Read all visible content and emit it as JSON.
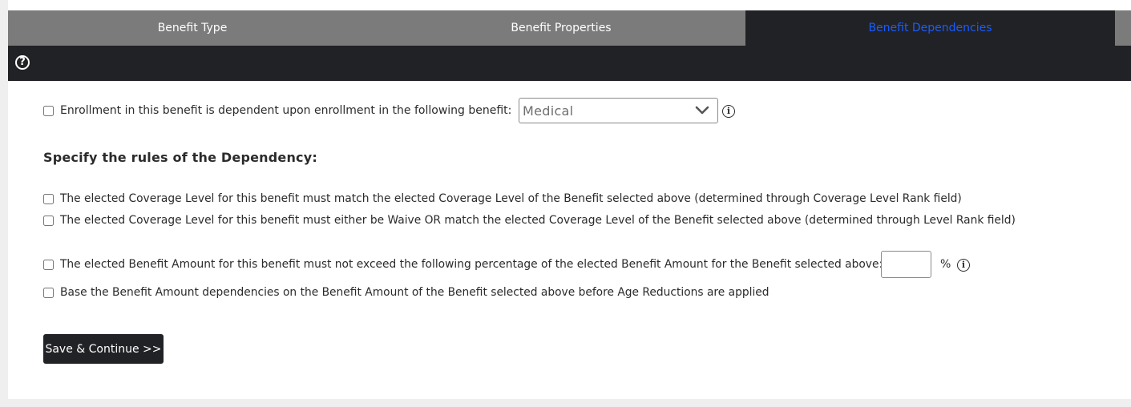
{
  "tabs": [
    {
      "label": "Benefit Type",
      "active": false
    },
    {
      "label": "Benefit Properties",
      "active": false
    },
    {
      "label": "Benefit Dependencies",
      "active": true
    }
  ],
  "help_icon": "question-circle-icon",
  "dependency": {
    "label": "Enrollment in this benefit is dependent upon enrollment in the following benefit:",
    "checked": false,
    "selected_benefit": "Medical",
    "info_icon": "info-circle-icon"
  },
  "rules_heading": "Specify the rules of the Dependency:",
  "rules": {
    "coverage_match": {
      "label": "The elected Coverage Level for this benefit must match the elected Coverage Level of the Benefit selected above (determined through Coverage Level Rank field)",
      "checked": false
    },
    "coverage_waive_or_match": {
      "label": "The elected Coverage Level for this benefit must either be Waive OR match the elected Coverage Level of the Benefit selected above (determined through Level Rank field)",
      "checked": false
    },
    "amount_limit": {
      "label": "The elected Benefit Amount for this benefit must not exceed the following percentage of the elected Benefit Amount for the Benefit selected above:",
      "checked": false,
      "percent_value": "",
      "percent_symbol": "%"
    },
    "age_reduction": {
      "label": "Base the Benefit Amount dependencies on the Benefit Amount of the Benefit selected above before Age Reductions are applied",
      "checked": false
    }
  },
  "save_button": "Save & Continue >>",
  "colors": {
    "active_tab_text": "#1a5cff",
    "dark_bar": "#212226",
    "tab_bg": "#7b7b7b"
  }
}
